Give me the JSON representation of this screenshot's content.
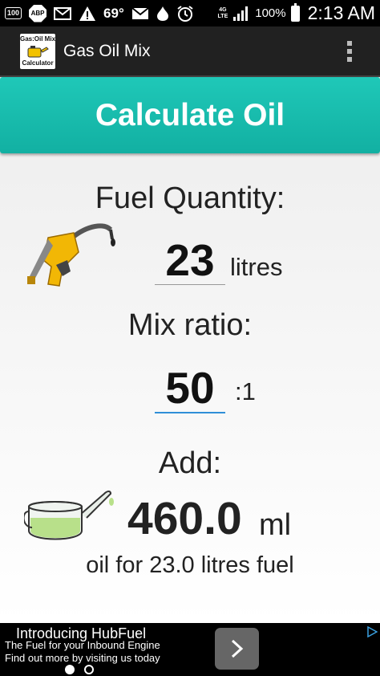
{
  "status_bar": {
    "notification_badge": "100",
    "abp_label": "ABP",
    "temperature": "69°",
    "network_top": "4G",
    "network_bottom": "LTE",
    "battery_percent": "100%",
    "time": "2:13 AM"
  },
  "app": {
    "icon_line1": "Gas:Oil Mix",
    "icon_line2": "Calculator",
    "title": "Gas Oil Mix"
  },
  "main": {
    "calculate_button": "Calculate Oil",
    "fuel_quantity_label": "Fuel Quantity:",
    "fuel_quantity_value": "23",
    "fuel_unit": "litres",
    "mix_ratio_label": "Mix ratio:",
    "mix_ratio_value": "50",
    "mix_ratio_suffix": ":1",
    "add_label": "Add:",
    "oil_amount": "460.0",
    "oil_unit": "ml",
    "result_text": "oil for 23.0 litres fuel"
  },
  "ad": {
    "title": "Introducing HubFuel",
    "line1": "The Fuel for your Inbound Engine",
    "line2": "Find out more by visiting us today"
  },
  "colors": {
    "accent": "#15b9aa",
    "action_bar": "#212121",
    "focus_underline": "#2f8fd8",
    "pump_yellow": "#f2b705"
  }
}
